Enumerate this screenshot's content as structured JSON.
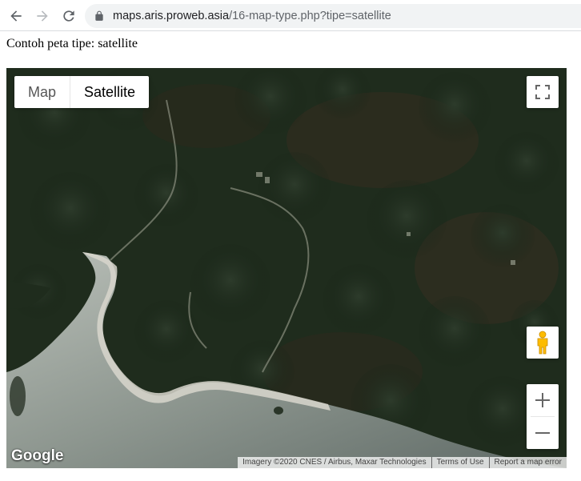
{
  "browser": {
    "url_host": "maps.aris.proweb.asia",
    "url_path": "/16-map-type.php?tipe=satellite",
    "icons": [
      "back-arrow-icon",
      "forward-arrow-icon",
      "reload-icon",
      "lock-icon"
    ]
  },
  "page": {
    "heading": "Contoh peta tipe: satellite"
  },
  "map": {
    "type_options": [
      {
        "label": "Map",
        "selected": false
      },
      {
        "label": "Satellite",
        "selected": true
      }
    ],
    "logo": "Google",
    "attribution": {
      "imagery": "Imagery ©2020 CNES / Airbus, Maxar Technologies",
      "terms": "Terms of Use",
      "report": "Report a map error"
    },
    "controls": [
      "fullscreen-icon",
      "pegman-icon",
      "zoom-in-icon",
      "zoom-out-icon"
    ]
  }
}
